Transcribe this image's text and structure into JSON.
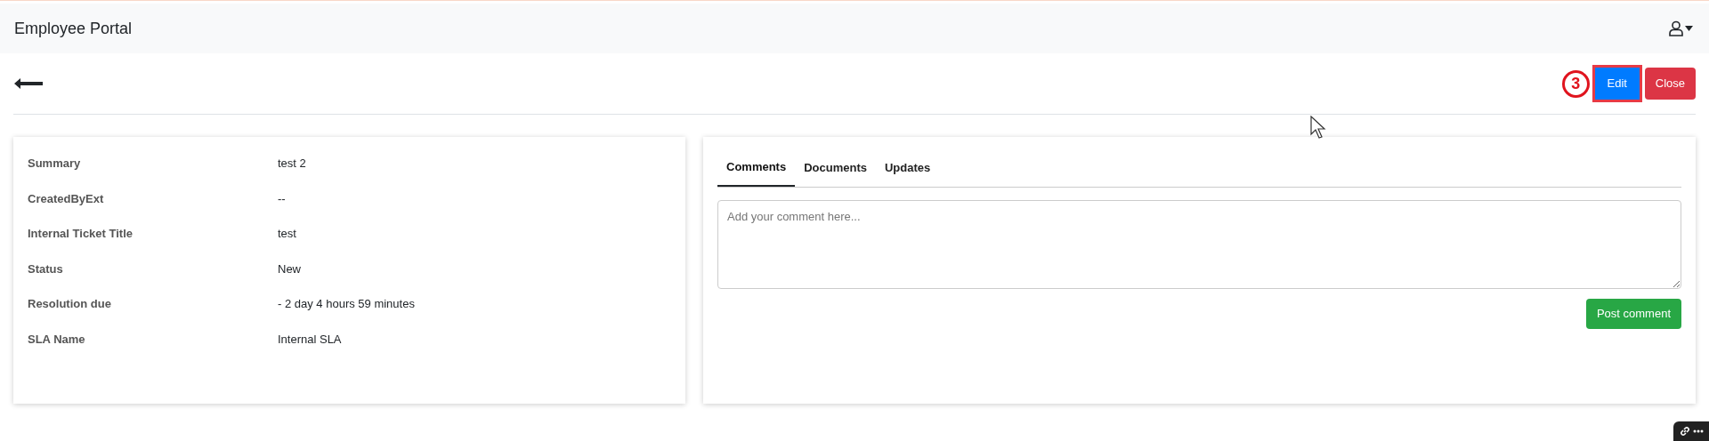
{
  "header": {
    "title": "Employee Portal"
  },
  "toolbar": {
    "step_marker": "3",
    "buttons": [
      {
        "label": "Edit",
        "kind": "primary",
        "highlighted": true
      },
      {
        "label": "Close",
        "kind": "danger",
        "highlighted": false
      }
    ]
  },
  "details": [
    {
      "label": "Summary",
      "value": "test 2"
    },
    {
      "label": "CreatedByExt",
      "value": "--"
    },
    {
      "label": "Internal Ticket Title",
      "value": "test"
    },
    {
      "label": "Status",
      "value": "New"
    },
    {
      "label": "Resolution due",
      "value": "- 2 day 4 hours 59 minutes"
    },
    {
      "label": "SLA Name",
      "value": "Internal SLA"
    }
  ],
  "tabs": [
    {
      "label": "Comments",
      "selected": true
    },
    {
      "label": "Documents",
      "selected": false
    },
    {
      "label": "Updates",
      "selected": false
    }
  ],
  "comment": {
    "placeholder": "Add your comment here...",
    "submit": "Post comment"
  }
}
